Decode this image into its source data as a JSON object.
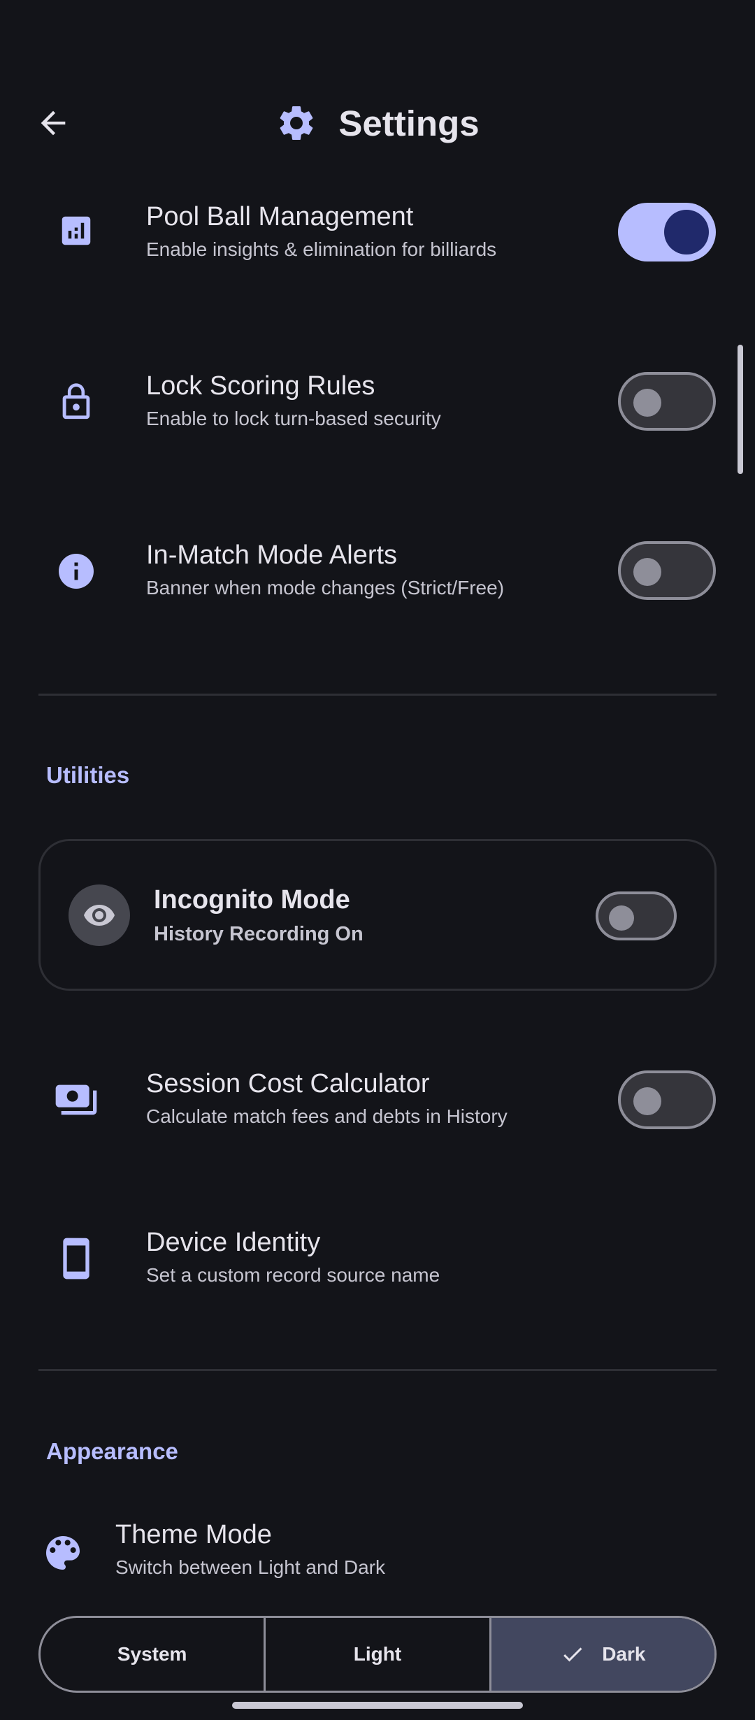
{
  "header": {
    "title": "Settings"
  },
  "rows": {
    "pool_ball": {
      "title": "Pool Ball Management",
      "subtitle": "Enable insights & elimination for billiards",
      "enabled": true
    },
    "lock_scoring": {
      "title": "Lock Scoring Rules",
      "subtitle": "Enable to lock turn-based security",
      "enabled": false
    },
    "mode_alerts": {
      "title": "In-Match Mode Alerts",
      "subtitle": "Banner when mode changes (Strict/Free)",
      "enabled": false
    }
  },
  "utilities": {
    "label": "Utilities",
    "incognito": {
      "title": "Incognito Mode",
      "subtitle": "History Recording On",
      "enabled": false
    },
    "cost_calc": {
      "title": "Session Cost Calculator",
      "subtitle": "Calculate match fees and debts in History",
      "enabled": false
    },
    "device_identity": {
      "title": "Device Identity",
      "subtitle": "Set a custom record source name"
    }
  },
  "appearance": {
    "label": "Appearance",
    "theme": {
      "title": "Theme Mode",
      "subtitle": "Switch between Light and Dark"
    },
    "options": [
      "System",
      "Light",
      "Dark"
    ],
    "selected": "Dark"
  },
  "icons": {
    "back": "arrow-back-icon",
    "settings": "gear-icon",
    "pool_ball": "bar-chart-icon",
    "lock": "lock-icon",
    "info": "info-icon",
    "eye": "eye-icon",
    "money": "payments-icon",
    "phone": "smartphone-icon",
    "palette": "palette-icon",
    "check": "check-icon"
  },
  "colors": {
    "background": "#131419",
    "accent": "#b7bdff",
    "toggle_on_knob": "#20296b"
  }
}
